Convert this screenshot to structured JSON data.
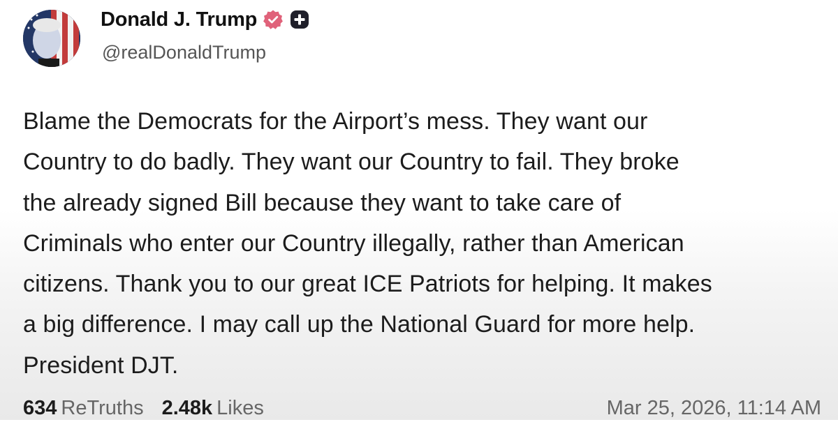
{
  "author": {
    "display_name": "Donald J. Trump",
    "handle": "@realDonaldTrump",
    "badge_color": "#e0627a"
  },
  "post": {
    "text": "Blame the Democrats for the Airport’s mess. They want our\nCountry to do badly. They want our Country to fail. They broke\nthe already signed Bill because they want to take care of\nCriminals who enter our Country illegally, rather than American\ncitizens. Thank you to our great ICE Patriots for helping. It makes\na big difference. I may call up the National Guard for more help.\nPresident DJT."
  },
  "stats": {
    "retruths_count": "634",
    "retruths_label": "ReTruths",
    "likes_count": "2.48k",
    "likes_label": "Likes"
  },
  "timestamp": "Mar 25, 2026, 11:14 AM",
  "icons": {
    "verified": "verified-badge-icon",
    "plus": "plus-badge-icon"
  }
}
